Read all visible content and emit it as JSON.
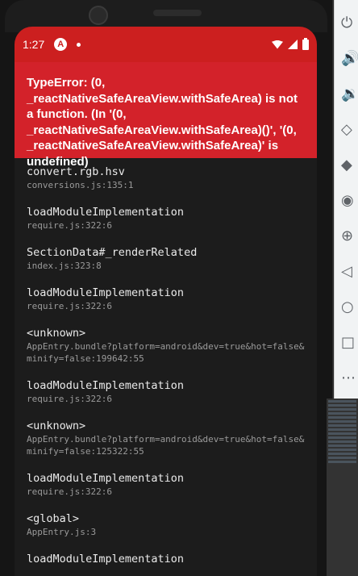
{
  "status_bar": {
    "time": "1:27",
    "app_icon_letter": "A"
  },
  "error": {
    "message": "TypeError: (0, _reactNativeSafeAreaView.withSafeArea) is not a function. (In '(0, _reactNativeSafeAreaView.withSafeArea)()', '(0, _reactNativeSafeAreaView.withSafeArea)' is undefined)"
  },
  "stack": [
    {
      "method": "convert.rgb.hsv",
      "file": "conversions.js:135:1"
    },
    {
      "method": "loadModuleImplementation",
      "file": "require.js:322:6"
    },
    {
      "method": "SectionData#_renderRelated",
      "file": "index.js:323:8"
    },
    {
      "method": "loadModuleImplementation",
      "file": "require.js:322:6"
    },
    {
      "method": "<unknown>",
      "file": "AppEntry.bundle?platform=android&dev=true&hot=false&minify=false:199642:55"
    },
    {
      "method": "loadModuleImplementation",
      "file": "require.js:322:6"
    },
    {
      "method": "<unknown>",
      "file": "AppEntry.bundle?platform=android&dev=true&hot=false&minify=false:125322:55"
    },
    {
      "method": "loadModuleImplementation",
      "file": "require.js:322:6"
    },
    {
      "method": "<global>",
      "file": "AppEntry.js:3"
    },
    {
      "method": "loadModuleImplementation",
      "file": ""
    }
  ],
  "side_tools": [
    "power-icon",
    "volume-up-icon",
    "volume-down-icon",
    "rotate-left-icon",
    "rotate-right-icon",
    "camera-icon",
    "zoom-icon",
    "back-icon",
    "home-icon",
    "overview-icon",
    "more-icon"
  ],
  "colors": {
    "status_bar": "#cc1f1f",
    "error_header": "#d3222a",
    "stack_bg": "#1c1c1c"
  }
}
